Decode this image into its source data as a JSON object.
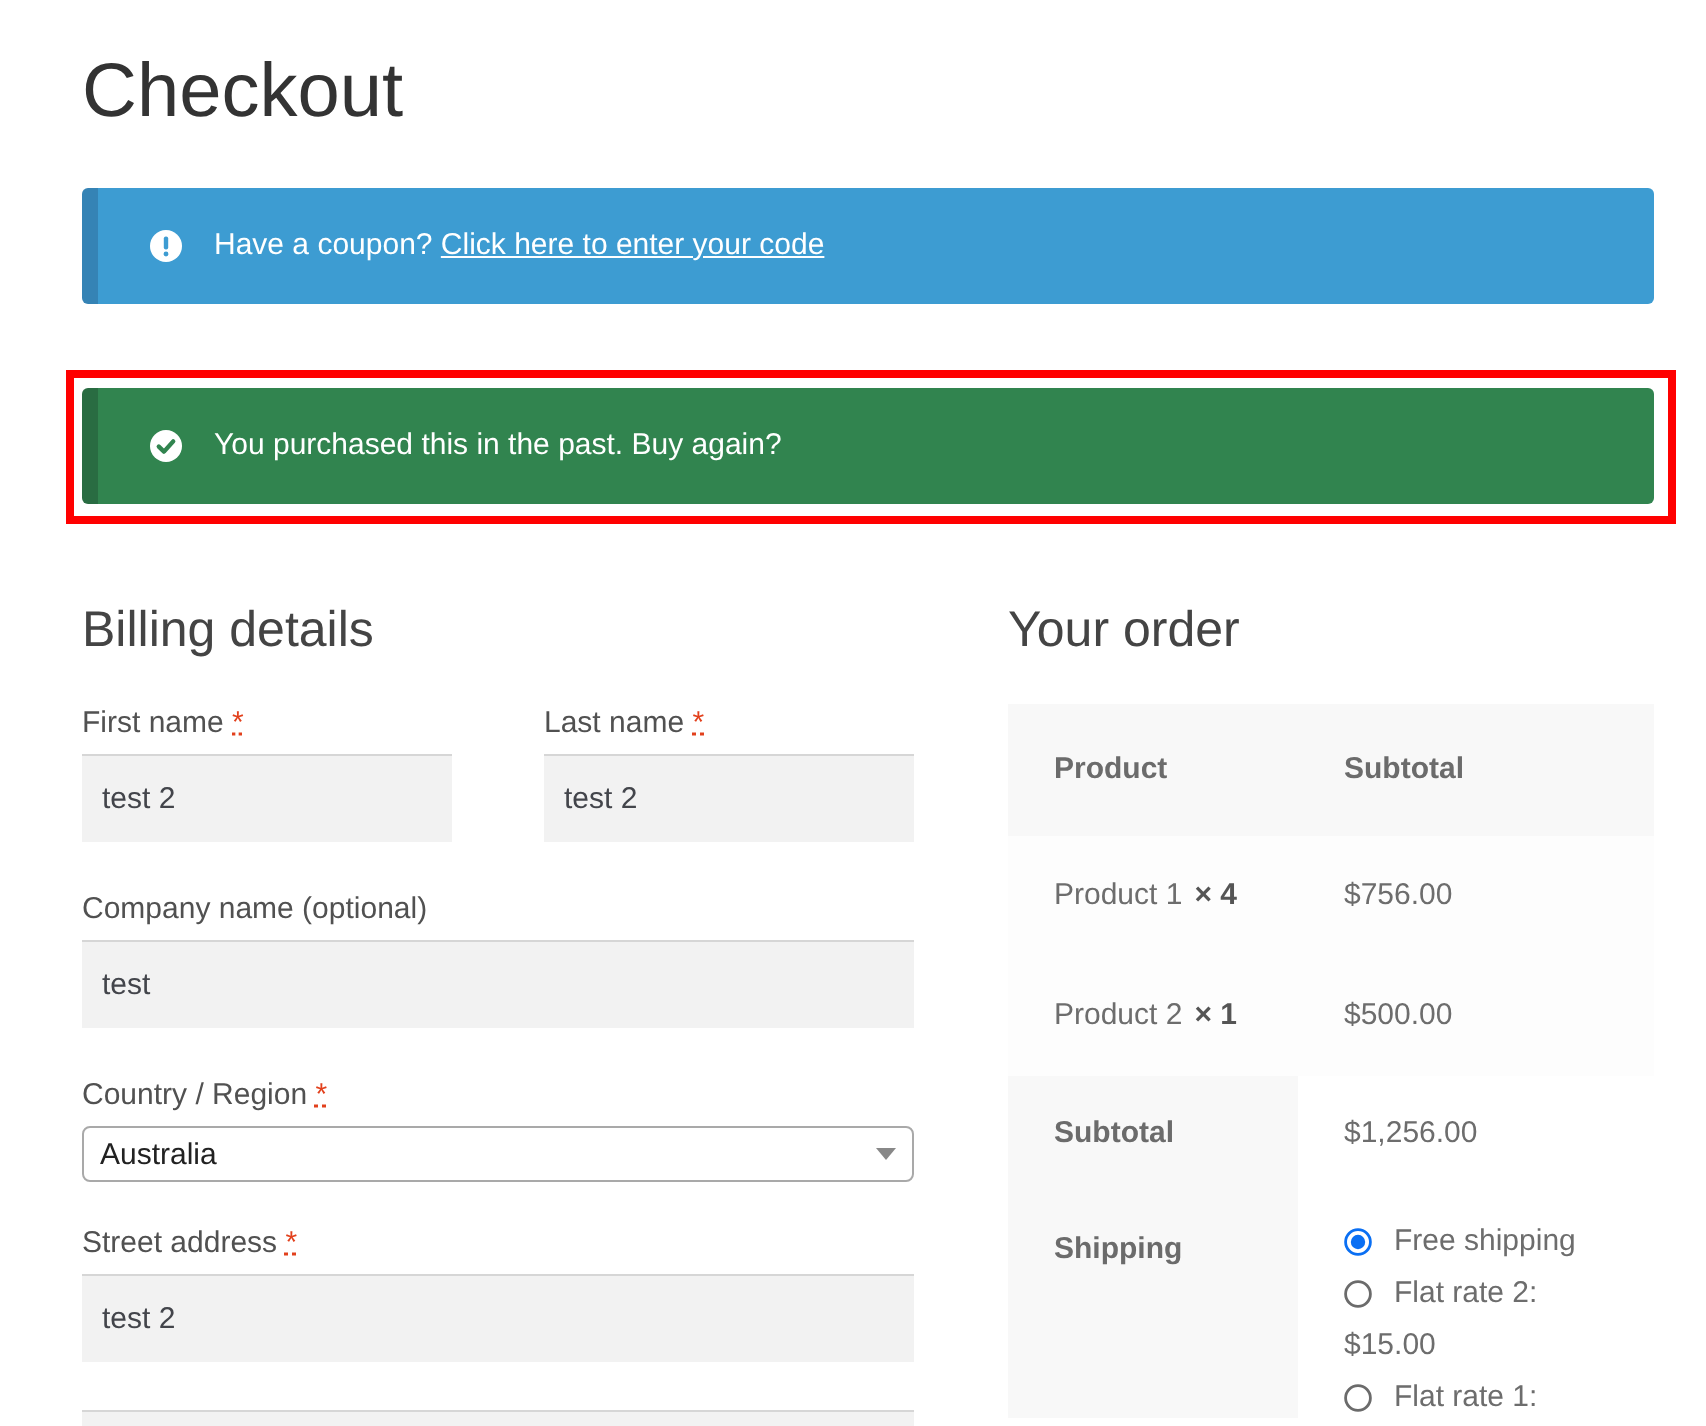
{
  "page": {
    "title": "Checkout"
  },
  "notices": [
    {
      "kind": "info",
      "text": "Have a coupon?",
      "link": "Click here to enter your code",
      "highlighted": false
    },
    {
      "kind": "success",
      "text": "You purchased this in the past. Buy again?",
      "highlighted": true
    }
  ],
  "billing": {
    "heading": "Billing details",
    "rows": [
      [
        {
          "kind": "text",
          "label": "First name",
          "mark": "*",
          "value": "test 2"
        },
        {
          "kind": "text",
          "label": "Last name",
          "mark": "*",
          "value": "test 2"
        }
      ],
      [
        {
          "kind": "text",
          "label": "Company name (optional)",
          "value": "test"
        }
      ],
      [
        {
          "kind": "select",
          "label": "Country / Region",
          "mark": "*",
          "value": "Australia"
        }
      ],
      [
        {
          "kind": "text",
          "label": "Street address",
          "mark": "*",
          "value": "test 2"
        }
      ],
      [
        {
          "kind": "text"
        }
      ]
    ]
  },
  "order": {
    "heading": "Your order",
    "columns": [
      "Product",
      "Subtotal"
    ],
    "items": [
      {
        "name": "Product 1",
        "quantity": "× 4",
        "total": "$756.00"
      },
      {
        "name": "Product 2",
        "quantity": "× 1",
        "total": "$500.00"
      }
    ],
    "totals": [
      {
        "kind": "amount",
        "label": "Subtotal",
        "value": "$1,256.00"
      },
      {
        "kind": "shipping",
        "label": "Shipping",
        "options": [
          {
            "label": "Free shipping",
            "selected": true
          },
          {
            "label": "Flat rate 2:",
            "price": "$15.00",
            "selected": false
          },
          {
            "label": "Flat rate 1:",
            "selected": false
          }
        ]
      }
    ]
  }
}
